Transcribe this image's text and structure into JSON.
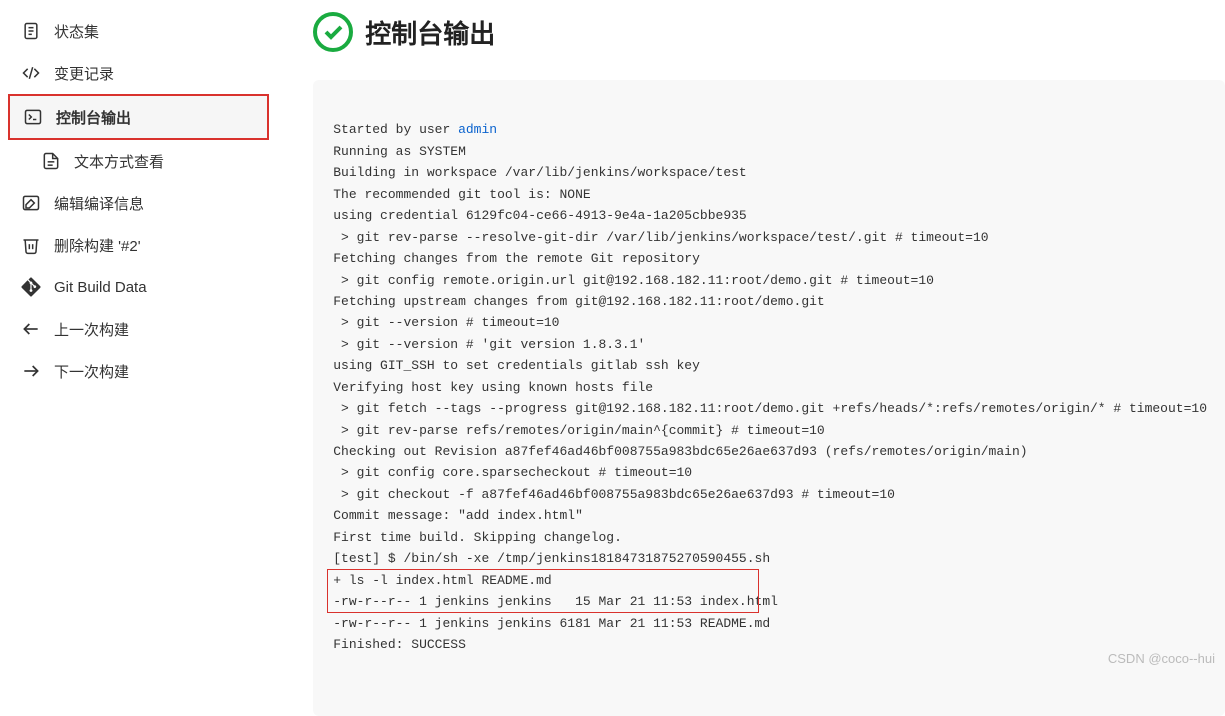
{
  "sidebar": {
    "items": [
      {
        "label": "状态集"
      },
      {
        "label": "变更记录"
      },
      {
        "label": "控制台输出"
      },
      {
        "label": "文本方式查看"
      },
      {
        "label": "编辑编译信息"
      },
      {
        "label": "删除构建 '#2'"
      },
      {
        "label": "Git Build Data"
      },
      {
        "label": "上一次构建"
      },
      {
        "label": "下一次构建"
      }
    ]
  },
  "header": {
    "title": "控制台输出"
  },
  "console": {
    "line0_prefix": "Started by user ",
    "line0_link": "admin",
    "line1": "Running as SYSTEM",
    "line2": "Building in workspace /var/lib/jenkins/workspace/test",
    "line3": "The recommended git tool is: NONE",
    "line4": "using credential 6129fc04-ce66-4913-9e4a-1a205cbbe935",
    "line5": " > git rev-parse --resolve-git-dir /var/lib/jenkins/workspace/test/.git # timeout=10",
    "line6": "Fetching changes from the remote Git repository",
    "line7": " > git config remote.origin.url git@192.168.182.11:root/demo.git # timeout=10",
    "line8": "Fetching upstream changes from git@192.168.182.11:root/demo.git",
    "line9": " > git --version # timeout=10",
    "line10": " > git --version # 'git version 1.8.3.1'",
    "line11": "using GIT_SSH to set credentials gitlab ssh key",
    "line12": "Verifying host key using known hosts file",
    "line13": " > git fetch --tags --progress git@192.168.182.11:root/demo.git +refs/heads/*:refs/remotes/origin/* # timeout=10",
    "line14": " > git rev-parse refs/remotes/origin/main^{commit} # timeout=10",
    "line15": "Checking out Revision a87fef46ad46bf008755a983bdc65e26ae637d93 (refs/remotes/origin/main)",
    "line16": " > git config core.sparsecheckout # timeout=10",
    "line17": " > git checkout -f a87fef46ad46bf008755a983bdc65e26ae637d93 # timeout=10",
    "line18": "Commit message: \"add index.html\"",
    "line19": "First time build. Skipping changelog.",
    "line20": "[test] $ /bin/sh -xe /tmp/jenkins18184731875270590455.sh",
    "line21": "+ ls -l index.html README.md",
    "line22": "-rw-r--r-- 1 jenkins jenkins   15 Mar 21 11:53 index.html",
    "line23": "-rw-r--r-- 1 jenkins jenkins 6181 Mar 21 11:53 README.md",
    "line24": "Finished: SUCCESS"
  },
  "watermark": "CSDN @coco--hui"
}
